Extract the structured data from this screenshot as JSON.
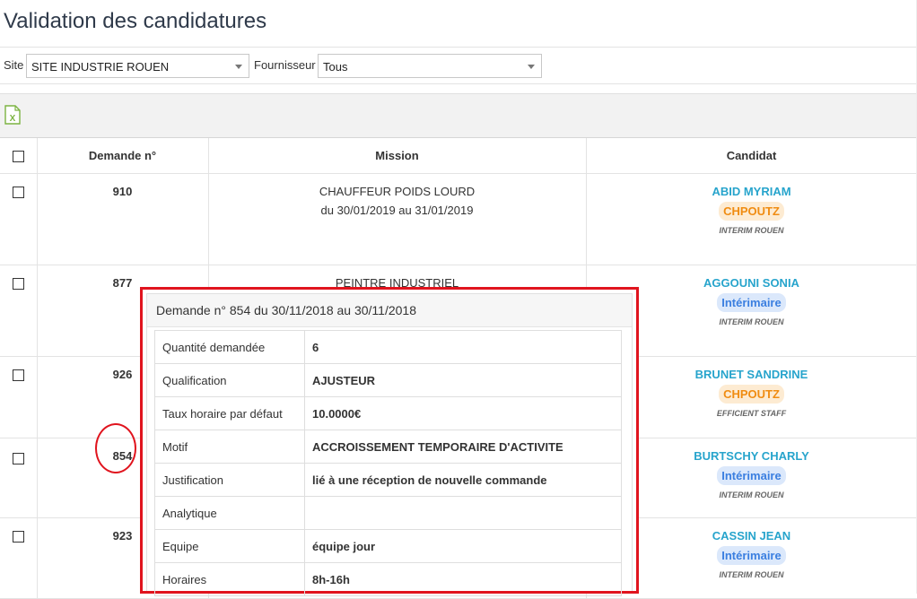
{
  "page": {
    "title": "Validation des candidatures"
  },
  "filters": {
    "site_label": "Site",
    "site_value": "SITE INDUSTRIE ROUEN",
    "supplier_label": "Fournisseur",
    "supplier_value": "Tous"
  },
  "toolbar": {
    "export_icon": "excel-icon"
  },
  "table": {
    "headers": {
      "demande": "Demande n°",
      "mission": "Mission",
      "candidat": "Candidat"
    },
    "rows": [
      {
        "num": "910",
        "mission": "CHAUFFEUR POIDS LOURD",
        "dates": "du 30/01/2019 au 31/01/2019",
        "name": "ABID MYRIAM",
        "badge": "CHPOUTZ",
        "agency": "INTERIM ROUEN"
      },
      {
        "num": "877",
        "mission": "PEINTRE INDUSTRIEL",
        "dates": "",
        "name": "AGGOUNI SONIA",
        "badge": "Intérimaire",
        "agency": "INTERIM ROUEN"
      },
      {
        "num": "926",
        "mission": "",
        "dates": "",
        "name": "BRUNET SANDRINE",
        "badge": "CHPOUTZ",
        "agency": "EFFICIENT STAFF"
      },
      {
        "num": "854",
        "mission": "",
        "dates": "",
        "name": "BURTSCHY CHARLY",
        "badge": "Intérimaire",
        "agency": "INTERIM ROUEN"
      },
      {
        "num": "923",
        "mission": "",
        "dates": "",
        "name": "CASSIN JEAN",
        "badge": "Intérimaire",
        "agency": "INTERIM ROUEN"
      }
    ]
  },
  "popup": {
    "title": "Demande n° 854 du 30/11/2018 au 30/11/2018",
    "rows": [
      {
        "k": "Quantité demandée",
        "v": "6"
      },
      {
        "k": "Qualification",
        "v": "AJUSTEUR"
      },
      {
        "k": "Taux horaire par défaut",
        "v": "10.0000€"
      },
      {
        "k": "Motif",
        "v": "ACCROISSEMENT TEMPORAIRE D'ACTIVITE"
      },
      {
        "k": "Justification",
        "v": "lié à une réception de nouvelle commande"
      },
      {
        "k": "Analytique",
        "v": ""
      },
      {
        "k": "Equipe",
        "v": "équipe jour"
      },
      {
        "k": "Horaires",
        "v": "8h-16h"
      }
    ]
  },
  "colors": {
    "accent_red": "#e0141e",
    "name_blue": "#27a4cc",
    "badge_orange": "#f08c12",
    "badge_blue": "#3b7fe0"
  }
}
